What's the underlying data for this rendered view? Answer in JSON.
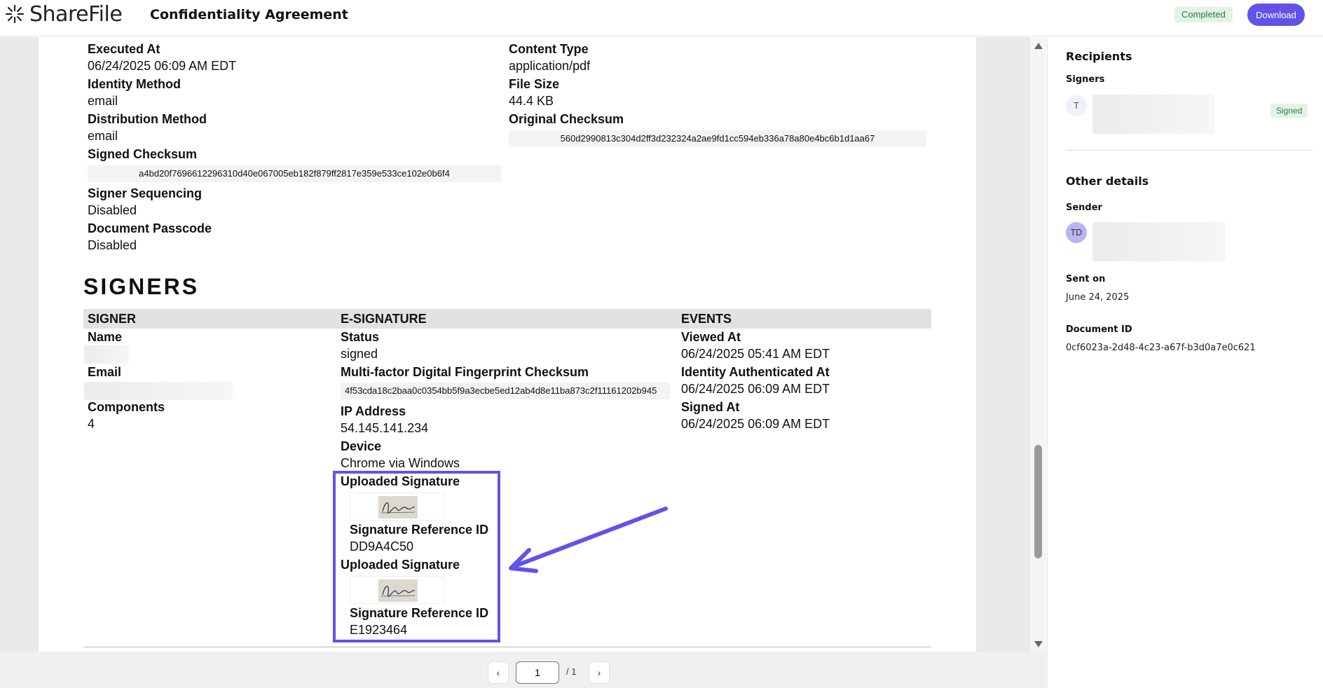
{
  "header": {
    "brand": "ShareFile",
    "document_title": "Confidentiality Agreement",
    "status_badge": "Completed",
    "download_label": "Download"
  },
  "document": {
    "executed_at_label": "Executed At",
    "executed_at": "06/24/2025 06:09 AM EDT",
    "identity_method_label": "Identity Method",
    "identity_method": "email",
    "distribution_method_label": "Distribution Method",
    "distribution_method": "email",
    "signed_checksum_label": "Signed Checksum",
    "signed_checksum": "a4bd20f7696612296310d40e067005eb182f879ff2817e359e533ce102e0b6f4",
    "signer_sequencing_label": "Signer Sequencing",
    "signer_sequencing": "Disabled",
    "document_passcode_label": "Document Passcode",
    "document_passcode": "Disabled",
    "content_type_label": "Content Type",
    "content_type": "application/pdf",
    "file_size_label": "File Size",
    "file_size": "44.4 KB",
    "original_checksum_label": "Original Checksum",
    "original_checksum": "560d2990813c304d2ff3d232324a2ae9fd1cc594eb336a78a80e4bc6b1d1aa67"
  },
  "signers": {
    "section_title": "SIGNERS",
    "columns": [
      "SIGNER",
      "E-SIGNATURE",
      "EVENTS"
    ],
    "signer": {
      "name_label": "Name",
      "email_label": "Email",
      "components_label": "Components",
      "components": "4"
    },
    "esignature": {
      "status_label": "Status",
      "status": "signed",
      "fingerprint_label": "Multi-factor Digital Fingerprint Checksum",
      "fingerprint": "4f53cda18c2baa0c0354bb5f9a3ecbe5ed12ab4d8e11ba873c2f11161202b945",
      "ip_label": "IP Address",
      "ip": "54.145.141.234",
      "device_label": "Device",
      "device": "Chrome via Windows",
      "uploads": [
        {
          "label": "Uploaded Signature",
          "ref_label": "Signature Reference ID",
          "ref": "DD9A4C50"
        },
        {
          "label": "Uploaded Signature",
          "ref_label": "Signature Reference ID",
          "ref": "E1923464"
        }
      ]
    },
    "events": {
      "viewed_label": "Viewed At",
      "viewed": "06/24/2025 05:41 AM EDT",
      "auth_label": "Identity Authenticated At",
      "auth": "06/24/2025 06:09 AM EDT",
      "signed_label": "Signed At",
      "signed": "06/24/2025 06:09 AM EDT"
    }
  },
  "pager": {
    "current": "1",
    "total": "/ 1",
    "prev": "‹",
    "next": "›"
  },
  "panel": {
    "recipients_title": "Recipients",
    "signers_label": "Signers",
    "signer_initial": "T",
    "signer_status": "Signed",
    "other_details_title": "Other details",
    "sender_label": "Sender",
    "sender_initials": "TD",
    "sent_on_label": "Sent on",
    "sent_on": "June 24, 2025",
    "document_id_label": "Document ID",
    "document_id": "0cf6023a-2d48-4c23-a67f-b3d0a7e0c621"
  },
  "colors": {
    "accent": "#6253e8",
    "success_bg": "#e3f4e6",
    "success_text": "#2d7a3e"
  }
}
